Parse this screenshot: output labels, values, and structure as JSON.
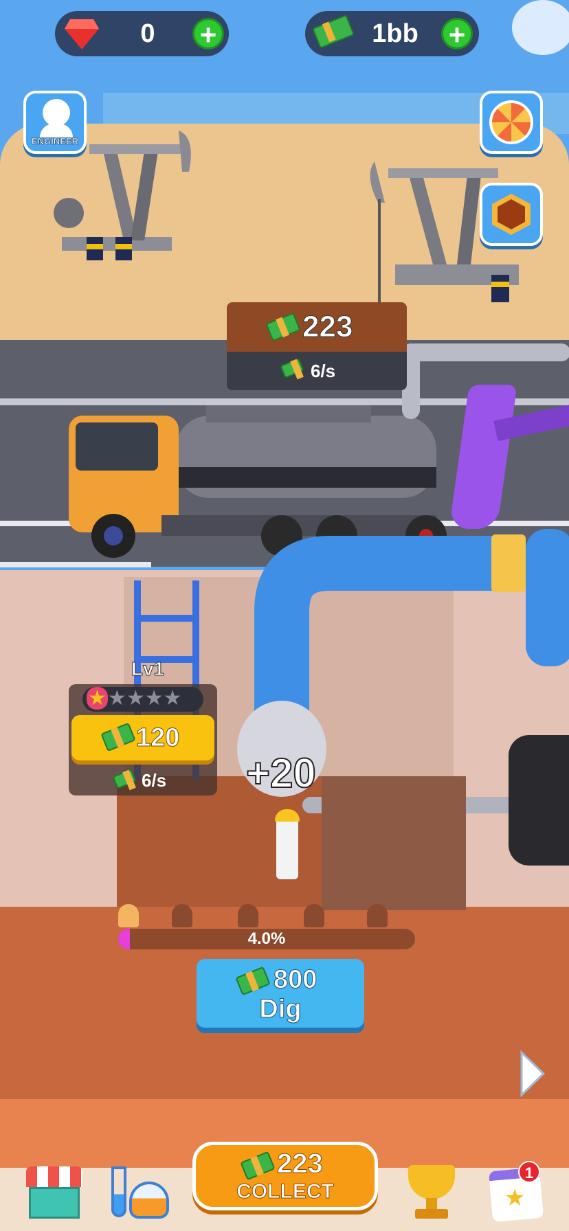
{
  "top_bar": {
    "gems": "0",
    "cash": "1bb"
  },
  "side_buttons": {
    "engineer_label": "ENGINEER"
  },
  "truck_panel": {
    "amount": "223",
    "rate": "6/s"
  },
  "well": {
    "level": "Lv1",
    "stars_filled": 1,
    "stars_total": 5,
    "upgrade_cost": "120",
    "rate": "6/s"
  },
  "floating_text": "+20",
  "dig": {
    "progress_text": "4.0%",
    "progress": 0.04,
    "cost": "800",
    "label": "Dig"
  },
  "bottom_nav": {
    "collect_amount": "223",
    "collect_label": "COLLECT",
    "calendar_badge": "1"
  },
  "colors": {
    "sky": "#5aa6ef",
    "sand": "#ecc58e",
    "road": "#5d5f6b",
    "dirt": "#c7683f",
    "collect": "#f79a14",
    "dig_button": "#44b6f0",
    "upgrade_button": "#f8c20f"
  }
}
